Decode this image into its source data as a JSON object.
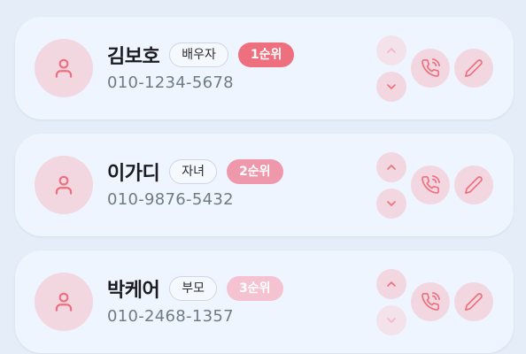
{
  "colors": {
    "page_bg": "#e5eef8",
    "card_bg": "#eef5fe",
    "accent": "#ee6f7e",
    "icon_circle_bg": "#f2d7e1",
    "priority_1": "#ee6f7e",
    "priority_2": "#f098ab",
    "priority_3": "#f4c2d1"
  },
  "contacts": [
    {
      "name": "김보호",
      "relation": "배우자",
      "priority": "1순위",
      "phone": "010-1234-5678",
      "avatar_icon": "person-icon",
      "move_up_icon": "chevron-up-icon",
      "move_down_icon": "chevron-down-icon",
      "call_icon": "phone-call-icon",
      "edit_icon": "pencil-icon"
    },
    {
      "name": "이가디",
      "relation": "자녀",
      "priority": "2순위",
      "phone": "010-9876-5432",
      "avatar_icon": "person-icon",
      "move_up_icon": "chevron-up-icon",
      "move_down_icon": "chevron-down-icon",
      "call_icon": "phone-call-icon",
      "edit_icon": "pencil-icon"
    },
    {
      "name": "박케어",
      "relation": "부모",
      "priority": "3순위",
      "phone": "010-2468-1357",
      "avatar_icon": "person-icon",
      "move_up_icon": "chevron-up-icon",
      "move_down_icon": "chevron-down-icon",
      "call_icon": "phone-call-icon",
      "edit_icon": "pencil-icon"
    }
  ]
}
